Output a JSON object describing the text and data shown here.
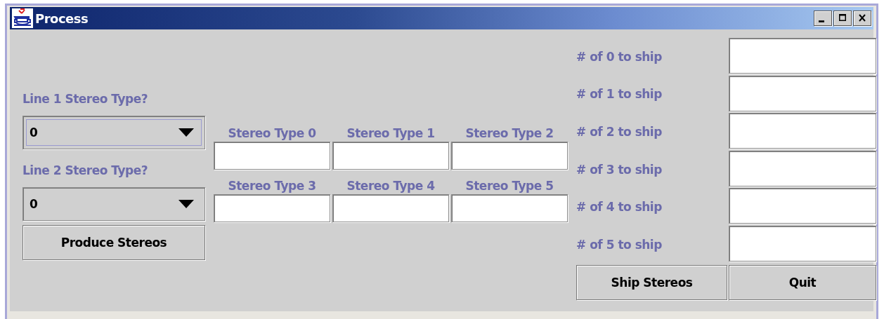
{
  "window": {
    "title": "Process"
  },
  "line_selectors": [
    {
      "label": "Line 1 Stereo Type?",
      "value": "0",
      "focused": true
    },
    {
      "label": "Line 2 Stereo Type?",
      "value": "0",
      "focused": false
    }
  ],
  "produce_button": "Produce Stereos",
  "stereo_types": [
    {
      "label": "Stereo Type 0"
    },
    {
      "label": "Stereo Type 1"
    },
    {
      "label": "Stereo Type 2"
    },
    {
      "label": "Stereo Type 3"
    },
    {
      "label": "Stereo Type 4"
    },
    {
      "label": "Stereo Type 5"
    }
  ],
  "ship_counts": [
    {
      "label": "# of 0 to ship"
    },
    {
      "label": "# of 1 to ship"
    },
    {
      "label": "# of 2 to ship"
    },
    {
      "label": "# of 3 to ship"
    },
    {
      "label": "# of 4 to ship"
    },
    {
      "label": "# of 5 to ship"
    }
  ],
  "buttons": [
    "Ship Stereos",
    "Quit"
  ]
}
